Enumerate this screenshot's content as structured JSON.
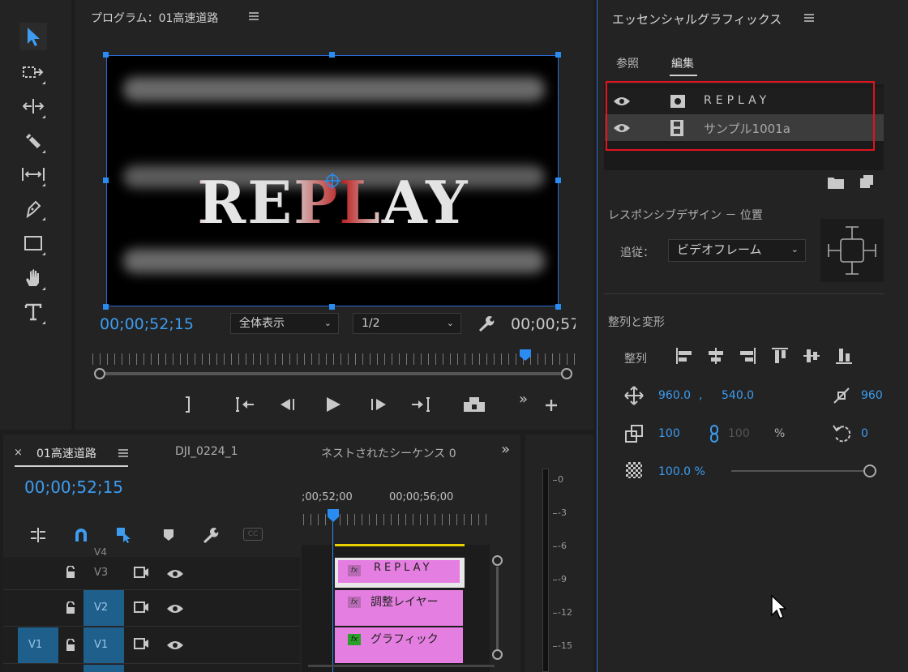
{
  "program": {
    "title": "プログラム：01高速道路",
    "timecode_left": "00;00;52;15",
    "timecode_right": "00;00;57",
    "fit_dropdown": "全体表示",
    "res_dropdown": "1/2",
    "video_title_text": "REPLAY"
  },
  "essential_graphics": {
    "title": "エッセンシャルグラフィックス",
    "tabs": [
      "参照",
      "編集"
    ],
    "layers": [
      {
        "name": "REPLAY"
      },
      {
        "name": "サンプル1001a"
      }
    ],
    "responsive_label": "レスポンシブデザイン － 位置",
    "follow_label": "追従：",
    "follow_value": "ビデオフレーム",
    "align_header": "整列と変形",
    "align_label": "整列",
    "position_x": "960.0",
    "position_sep": ",",
    "position_y": "540.0",
    "anchor_value": "960",
    "scale_value": "100",
    "scale_linked_value": "100",
    "percent": "%",
    "rotation_value": "0",
    "opacity_value": "100.0 %"
  },
  "timeline": {
    "tabs": [
      "01高速道路",
      "DJI_0224_1",
      "ネストされたシーケンス 0"
    ],
    "timecode": "00;00;52;15",
    "ruler_labels": [
      ";00;52;00",
      "00;00;56;00"
    ],
    "tracks": [
      {
        "name": "V4"
      },
      {
        "name": "V3"
      },
      {
        "name": "V2"
      },
      {
        "name": "V1",
        "source": "V1"
      }
    ],
    "clips": [
      {
        "label": "REPLAY"
      },
      {
        "label": "調整レイヤー"
      },
      {
        "label": "グラフィック"
      }
    ]
  },
  "meter": {
    "labels": [
      "0",
      "-3",
      "-6",
      "-9",
      "-12",
      "-15"
    ]
  },
  "colors": {
    "accent": "#3d9cf0",
    "highlight_box": "#e0141e",
    "clip_pink": "#e47ee0",
    "track_blue": "#1f5f8c",
    "yellow": "#e8d000"
  }
}
